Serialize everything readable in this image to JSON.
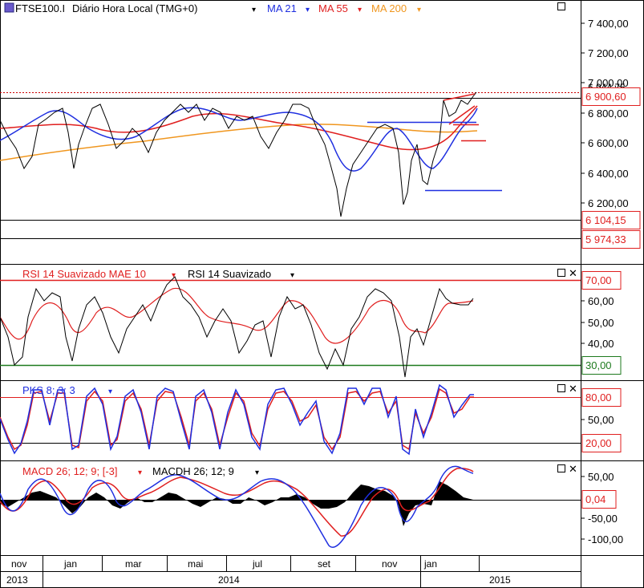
{
  "main": {
    "symbol": "FTSE100.I",
    "title_text": "Diário Hora Local (TMG+0)",
    "indicators": [
      {
        "label": "MA 21",
        "color": "#1f2fe0"
      },
      {
        "label": "MA 55",
        "color": "#e01f1f"
      },
      {
        "label": "MA 200",
        "color": "#f0961e"
      }
    ],
    "y_ticks": [
      "7 400,00",
      "7 200,00",
      "7 000,00",
      "6 800,00",
      "6 600,00",
      "6 400,00",
      "6 200,00"
    ],
    "price_tags": [
      {
        "text": "6 900,60",
        "color": "#e01f1f"
      },
      {
        "text": "6 104,15",
        "color": "#e01f1f"
      },
      {
        "text": "5 974,33",
        "color": "#e01f1f"
      }
    ],
    "partial_tag": "6 944,75"
  },
  "rsi": {
    "label1": "RSI 14 Suavizado MAE 10",
    "label2": "RSI 14 Suavizado",
    "y_ticks": [
      "60,00",
      "50,00",
      "40,00"
    ],
    "level_tags": [
      {
        "text": "70,00",
        "color": "#e01f1f"
      },
      {
        "text": "30,00",
        "color": "#1e7a1e"
      }
    ]
  },
  "pks": {
    "label": "PKS 8; 3; 3",
    "y_ticks": [
      "50,00"
    ],
    "level_tags": [
      {
        "text": "80,00"
      },
      {
        "text": "20,00"
      }
    ]
  },
  "macd": {
    "label1": "MACD 26; 12; 9; [-3]",
    "label2": "MACDH 26; 12; 9",
    "y_ticks": [
      "50,00",
      "-50,00",
      "-100,00"
    ],
    "value_tag": "0,04"
  },
  "x_axis": {
    "months": [
      "nov",
      "jan",
      "mar",
      "mai",
      "jul",
      "set",
      "nov",
      "jan"
    ],
    "years": [
      "2013",
      "2014",
      "2015"
    ]
  },
  "chart_data": {
    "type": "line",
    "title": "FTSE100.I Diário Hora Local (TMG+0)",
    "x_range": [
      "2013-10",
      "2015-02"
    ],
    "price_ylim": [
      6050,
      7560
    ],
    "series": [
      {
        "name": "FTSE100.I",
        "points": [
          [
            "2013-10",
            6600
          ],
          [
            "2013-11",
            6470
          ],
          [
            "2013-12",
            6680
          ],
          [
            "2014-01",
            6850
          ],
          [
            "2014-02",
            6760
          ],
          [
            "2014-03",
            6620
          ],
          [
            "2014-04",
            6650
          ],
          [
            "2014-05",
            6830
          ],
          [
            "2014-06",
            6790
          ],
          [
            "2014-07",
            6760
          ],
          [
            "2014-08",
            6870
          ],
          [
            "2014-09",
            6800
          ],
          [
            "2014-10",
            6200
          ],
          [
            "2014-11",
            6700
          ],
          [
            "2014-12",
            6150
          ],
          [
            "2015-01",
            6800
          ],
          [
            "2015-02",
            6940
          ]
        ]
      },
      {
        "name": "MA 21",
        "points": [
          [
            "2013-10",
            6650
          ],
          [
            "2013-12",
            6620
          ],
          [
            "2014-02",
            6730
          ],
          [
            "2014-04",
            6640
          ],
          [
            "2014-06",
            6800
          ],
          [
            "2014-08",
            6800
          ],
          [
            "2014-10",
            6350
          ],
          [
            "2014-11",
            6700
          ],
          [
            "2014-12",
            6480
          ],
          [
            "2015-02",
            6880
          ]
        ]
      },
      {
        "name": "MA 55",
        "points": [
          [
            "2013-10",
            6660
          ],
          [
            "2014-01",
            6700
          ],
          [
            "2014-03",
            6660
          ],
          [
            "2014-06",
            6760
          ],
          [
            "2014-08",
            6770
          ],
          [
            "2014-10",
            6600
          ],
          [
            "2014-12",
            6540
          ],
          [
            "2015-02",
            6850
          ]
        ]
      },
      {
        "name": "MA 200",
        "points": [
          [
            "2013-10",
            6500
          ],
          [
            "2014-04",
            6650
          ],
          [
            "2014-09",
            6730
          ],
          [
            "2014-12",
            6680
          ],
          [
            "2015-02",
            6690
          ]
        ]
      }
    ],
    "rsi": {
      "levels": [
        30,
        70
      ],
      "ylim": [
        22,
        75
      ]
    },
    "pks": {
      "levels": [
        20,
        80
      ],
      "ylim": [
        0,
        100
      ]
    },
    "macd": {
      "ylim": [
        -125,
        80
      ]
    }
  }
}
